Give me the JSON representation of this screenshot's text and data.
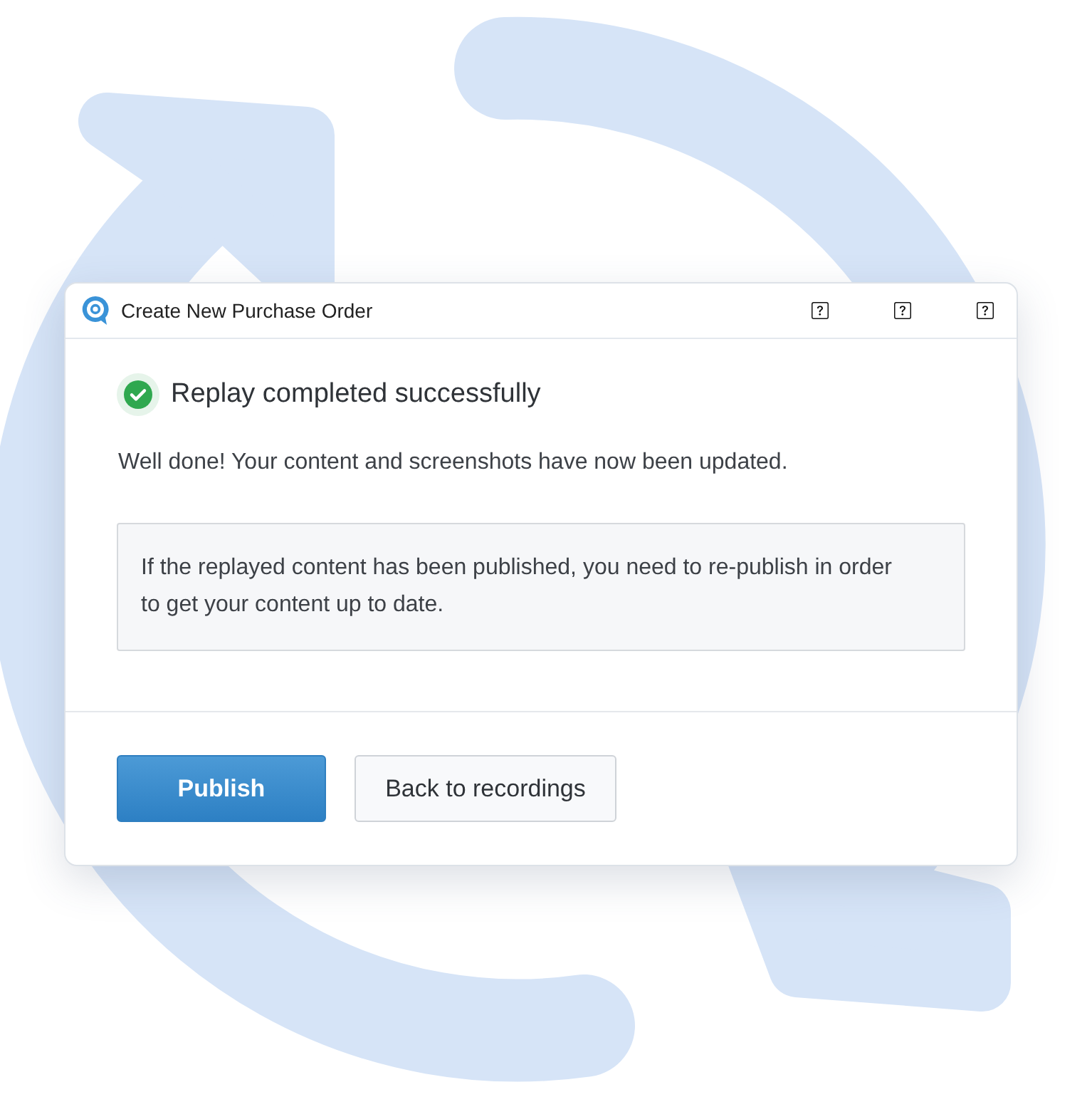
{
  "window": {
    "title": "Create New Purchase Order",
    "toolbar": [
      {
        "kind": "help"
      },
      {
        "kind": "help"
      },
      {
        "kind": "help"
      }
    ]
  },
  "status": {
    "kind": "success",
    "title": "Replay completed successfully"
  },
  "message": "Well done! Your content and screenshots have now been updated.",
  "note": "If the replayed content has been published, you need to re-publish in order to get your content up to date.",
  "buttons": [
    {
      "label": "Publish",
      "kind": "primary"
    },
    {
      "label": "Back to recordings",
      "kind": "secondary"
    }
  ]
}
